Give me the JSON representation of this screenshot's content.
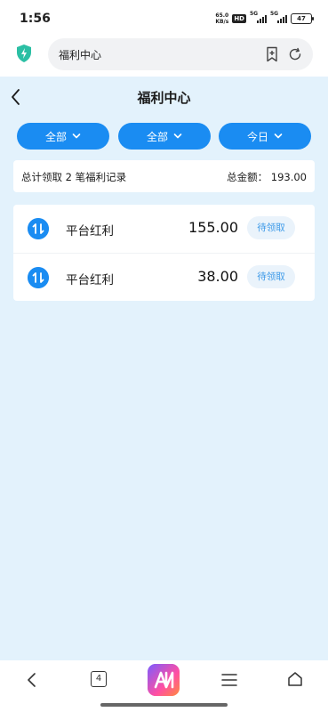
{
  "status_bar": {
    "time": "1:56",
    "net_speed_value": "65.0",
    "net_speed_unit": "KB/s",
    "hd_badge": "HD",
    "signal1_label": "5G",
    "signal2_label": "5G",
    "battery": "47"
  },
  "browser": {
    "url_text": "福利中心",
    "shield_icon": "shield-bolt-icon",
    "bookmark_icon": "bookmark-add-icon",
    "reload_icon": "reload-icon"
  },
  "page": {
    "title": "福利中心",
    "filters": [
      {
        "label": "全部"
      },
      {
        "label": "全部"
      },
      {
        "label": "今日"
      }
    ],
    "summary": {
      "left": "总计领取 2 笔福利记录",
      "right": "总金额：  193.00"
    },
    "items": [
      {
        "name": "平台红利",
        "amount": "155.00",
        "status": "待领取"
      },
      {
        "name": "平台红利",
        "amount": "38.00",
        "status": "待领取"
      }
    ]
  },
  "bottom_nav": {
    "tabs_count": "4"
  },
  "colors": {
    "accent": "#1a8cf2",
    "page_bg": "#e3f2fc",
    "status_text": "#3d9ae8"
  }
}
